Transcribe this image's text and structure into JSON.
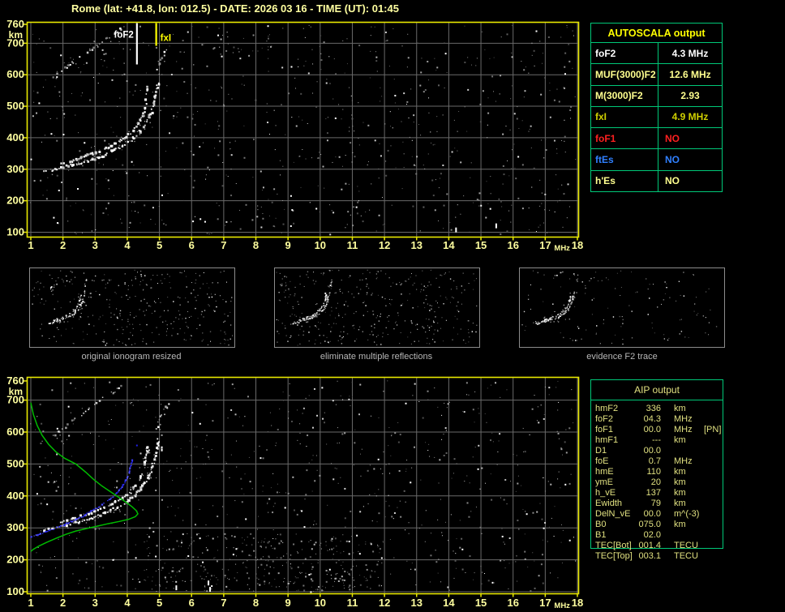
{
  "title": "Rome (lat: +41.8, lon: 012.5) - DATE: 2026 03 16 - TIME (UT): 01:45",
  "colors": {
    "background": "#000000",
    "title_text": "#ffffa0",
    "border_yellow": "#e8e800",
    "axis_label_yellow": "#ffff9f",
    "grid_gray": "#6a6a6a",
    "table_border_green": "#00c878",
    "autoscala_header": "#ffff00",
    "aip_text": "#e0e080",
    "caption_gray": "#b8b8b8",
    "thumb_border_gray": "#8c8c8c",
    "trace_white": "#ffffff",
    "profile_green": "#00bb00",
    "restored_trace_blue": "#2828ee",
    "marker_foF2": "#ffffff",
    "marker_fxI": "#ffff00"
  },
  "autoscala_table": {
    "header": "AUTOSCALA output",
    "rows": [
      {
        "label": "foF2",
        "value": "4.3 MHz",
        "color": "#ffffff"
      },
      {
        "label": "MUF(3000)F2",
        "value": "12.6 MHz",
        "color": "#ffff8f"
      },
      {
        "label": "M(3000)F2",
        "value": "2.93",
        "color": "#ffff8f"
      },
      {
        "label": "fxI",
        "value": "4.9 MHz",
        "color": "#d0d000"
      },
      {
        "label": "foF1",
        "value": "NO",
        "color": "#ff2020"
      },
      {
        "label": "ftEs",
        "value": "NO",
        "color": "#3080ff"
      },
      {
        "label": "h'Es",
        "value": "NO",
        "color": "#ffff8f"
      }
    ]
  },
  "aip_table": {
    "header": "AIP output",
    "rows": [
      {
        "label": "hmF2",
        "value": "336",
        "unit": "km",
        "extra": ""
      },
      {
        "label": "foF2",
        "value": "04.3",
        "unit": "MHz",
        "extra": ""
      },
      {
        "label": "foF1",
        "value": "00.0",
        "unit": "MHz",
        "extra": "[PN]"
      },
      {
        "label": "hmF1",
        "value": "---",
        "unit": "km",
        "extra": ""
      },
      {
        "label": "D1",
        "value": "00.0",
        "unit": "",
        "extra": ""
      },
      {
        "label": "foE",
        "value": "0.7",
        "unit": "MHz",
        "extra": ""
      },
      {
        "label": "hmE",
        "value": "110",
        "unit": "km",
        "extra": ""
      },
      {
        "label": "ymE",
        "value": "20",
        "unit": "km",
        "extra": ""
      },
      {
        "label": "h_vE",
        "value": "137",
        "unit": "km",
        "extra": ""
      },
      {
        "label": "Ewidth",
        "value": "79",
        "unit": "km",
        "extra": ""
      },
      {
        "label": "DelN_vE",
        "value": "00.0",
        "unit": "m^(-3)",
        "extra": ""
      },
      {
        "label": "B0",
        "value": "075.0",
        "unit": "km",
        "extra": ""
      },
      {
        "label": "B1",
        "value": "02.0",
        "unit": "",
        "extra": ""
      },
      {
        "label": "TEC[Bot]",
        "value": "001.4",
        "unit": "TECU",
        "extra": ""
      },
      {
        "label": "TEC[Top]",
        "value": "003.1",
        "unit": "TECU",
        "extra": ""
      }
    ]
  },
  "thumbnails": [
    {
      "caption": "original ionogram resized"
    },
    {
      "caption": "eliminate multiple reflections"
    },
    {
      "caption": "evidence F2 trace"
    }
  ],
  "chart_data": {
    "type": "scatter",
    "axes": {
      "xlabel": "MHz",
      "ylabel": "km",
      "xlim": [
        1,
        18
      ],
      "ylim": [
        100,
        760
      ],
      "xticks": [
        1,
        2,
        3,
        4,
        5,
        6,
        7,
        8,
        9,
        10,
        11,
        12,
        13,
        14,
        15,
        16,
        17,
        18
      ],
      "yticks": [
        100,
        200,
        300,
        400,
        500,
        600,
        700,
        760
      ],
      "grid": true
    },
    "plots": [
      {
        "id": "scaled-ionogram",
        "series": [
          "second_reflection",
          "second_reflection_upper",
          "f2_ordinary",
          "f2_extraordinary"
        ],
        "markers": [
          {
            "name": "foF2",
            "mhz": 4.3,
            "color": "#ffffff",
            "label_side": "left",
            "line_len": 52
          },
          {
            "name": "fxI",
            "mhz": 4.9,
            "color": "#ffff00",
            "label_side": "right",
            "line_len": 29
          }
        ]
      },
      {
        "id": "profile-ionogram",
        "series": [
          "second_reflection",
          "second_reflection_upper",
          "f2_ordinary",
          "f2_extraordinary",
          "restored_f2_trace",
          "density_profile"
        ],
        "markers": []
      }
    ],
    "traces": {
      "f2_ordinary": {
        "render": "dots",
        "color": "#ffffff",
        "points": [
          [
            1.95,
            316
          ],
          [
            2.2,
            324
          ],
          [
            2.45,
            332
          ],
          [
            2.7,
            341
          ],
          [
            2.95,
            350
          ],
          [
            3.2,
            360
          ],
          [
            3.45,
            371
          ],
          [
            3.65,
            382
          ],
          [
            3.85,
            394
          ],
          [
            4.05,
            408
          ],
          [
            4.2,
            423
          ],
          [
            4.32,
            440
          ],
          [
            4.42,
            458
          ],
          [
            4.5,
            478
          ],
          [
            4.55,
            500
          ],
          [
            4.59,
            522
          ],
          [
            4.62,
            545
          ],
          [
            4.65,
            566
          ]
        ]
      },
      "f2_extraordinary": {
        "render": "dots",
        "color": "#ffffff",
        "points": [
          [
            1.4,
            293
          ],
          [
            1.7,
            299
          ],
          [
            2.0,
            306
          ],
          [
            2.3,
            313
          ],
          [
            2.6,
            321
          ],
          [
            2.9,
            330
          ],
          [
            3.2,
            341
          ],
          [
            3.5,
            354
          ],
          [
            3.75,
            367
          ],
          [
            4.0,
            382
          ],
          [
            4.2,
            398
          ],
          [
            4.38,
            416
          ],
          [
            4.52,
            436
          ],
          [
            4.65,
            458
          ],
          [
            4.75,
            482
          ],
          [
            4.83,
            508
          ],
          [
            4.89,
            533
          ],
          [
            4.94,
            557
          ],
          [
            4.98,
            580
          ]
        ]
      },
      "second_reflection": {
        "render": "dots-sparse",
        "color": "#d0d0d0",
        "points": [
          [
            1.7,
            585
          ],
          [
            1.95,
            608
          ],
          [
            2.2,
            628
          ],
          [
            2.45,
            648
          ],
          [
            2.7,
            667
          ],
          [
            2.95,
            686
          ],
          [
            3.2,
            704
          ],
          [
            3.45,
            721
          ],
          [
            3.7,
            738
          ],
          [
            3.9,
            752
          ]
        ]
      },
      "second_reflection_top": {
        "render": "dots-sparse",
        "color": "#d0d0d0",
        "points": [
          [
            3.0,
            692
          ],
          [
            3.2,
            704
          ],
          [
            3.45,
            721
          ],
          [
            3.7,
            738
          ],
          [
            3.9,
            752
          ]
        ]
      },
      "second_reflection_upper": {
        "render": "dots-sparse",
        "color": "#d0d0d0",
        "points": [
          [
            4.95,
            612
          ],
          [
            5.05,
            638
          ],
          [
            5.15,
            663
          ],
          [
            5.25,
            688
          ]
        ]
      },
      "restored_f2_trace": {
        "render": "dots-fine",
        "color": "#2828ee",
        "points": [
          [
            1.0,
            272
          ],
          [
            1.2,
            278
          ],
          [
            1.4,
            285
          ],
          [
            1.6,
            292
          ],
          [
            1.8,
            300
          ],
          [
            2.0,
            308
          ],
          [
            2.2,
            317
          ],
          [
            2.4,
            326
          ],
          [
            2.6,
            336
          ],
          [
            2.8,
            347
          ],
          [
            3.0,
            358
          ],
          [
            3.2,
            371
          ],
          [
            3.4,
            385
          ],
          [
            3.6,
            401
          ],
          [
            3.75,
            417
          ],
          [
            3.88,
            434
          ],
          [
            3.98,
            452
          ],
          [
            4.05,
            470
          ],
          [
            4.1,
            488
          ],
          [
            4.14,
            504
          ],
          [
            4.17,
            518
          ]
        ],
        "isolated_points": [
          [
            4.3,
            558
          ]
        ]
      },
      "density_profile": {
        "render": "line",
        "color": "#00bb00",
        "points": [
          [
            1.0,
            692
          ],
          [
            1.08,
            655
          ],
          [
            1.2,
            620
          ],
          [
            1.35,
            590
          ],
          [
            1.55,
            562
          ],
          [
            1.78,
            538
          ],
          [
            2.05,
            518
          ],
          [
            2.4,
            500
          ],
          [
            2.7,
            475
          ],
          [
            2.95,
            452
          ],
          [
            3.2,
            432
          ],
          [
            3.45,
            415
          ],
          [
            3.7,
            398
          ],
          [
            3.95,
            381
          ],
          [
            4.15,
            366
          ],
          [
            4.28,
            354
          ],
          [
            4.33,
            344
          ],
          [
            4.25,
            335
          ],
          [
            4.05,
            327
          ],
          [
            3.75,
            320
          ],
          [
            3.4,
            313
          ],
          [
            3.05,
            305
          ],
          [
            2.7,
            297
          ],
          [
            2.4,
            290
          ],
          [
            2.1,
            280
          ],
          [
            1.8,
            268
          ],
          [
            1.5,
            255
          ],
          [
            1.25,
            243
          ],
          [
            1.08,
            233
          ],
          [
            1.0,
            226
          ]
        ]
      }
    },
    "thumbnail_series": [
      [
        "second_reflection",
        "second_reflection_upper",
        "f2_ordinary",
        "f2_extraordinary"
      ],
      [
        "second_reflection_top",
        "second_reflection_upper",
        "f2_ordinary",
        "f2_extraordinary"
      ],
      [
        "second_reflection_top",
        "second_reflection_upper",
        "f2_ordinary",
        "f2_extraordinary"
      ]
    ]
  }
}
